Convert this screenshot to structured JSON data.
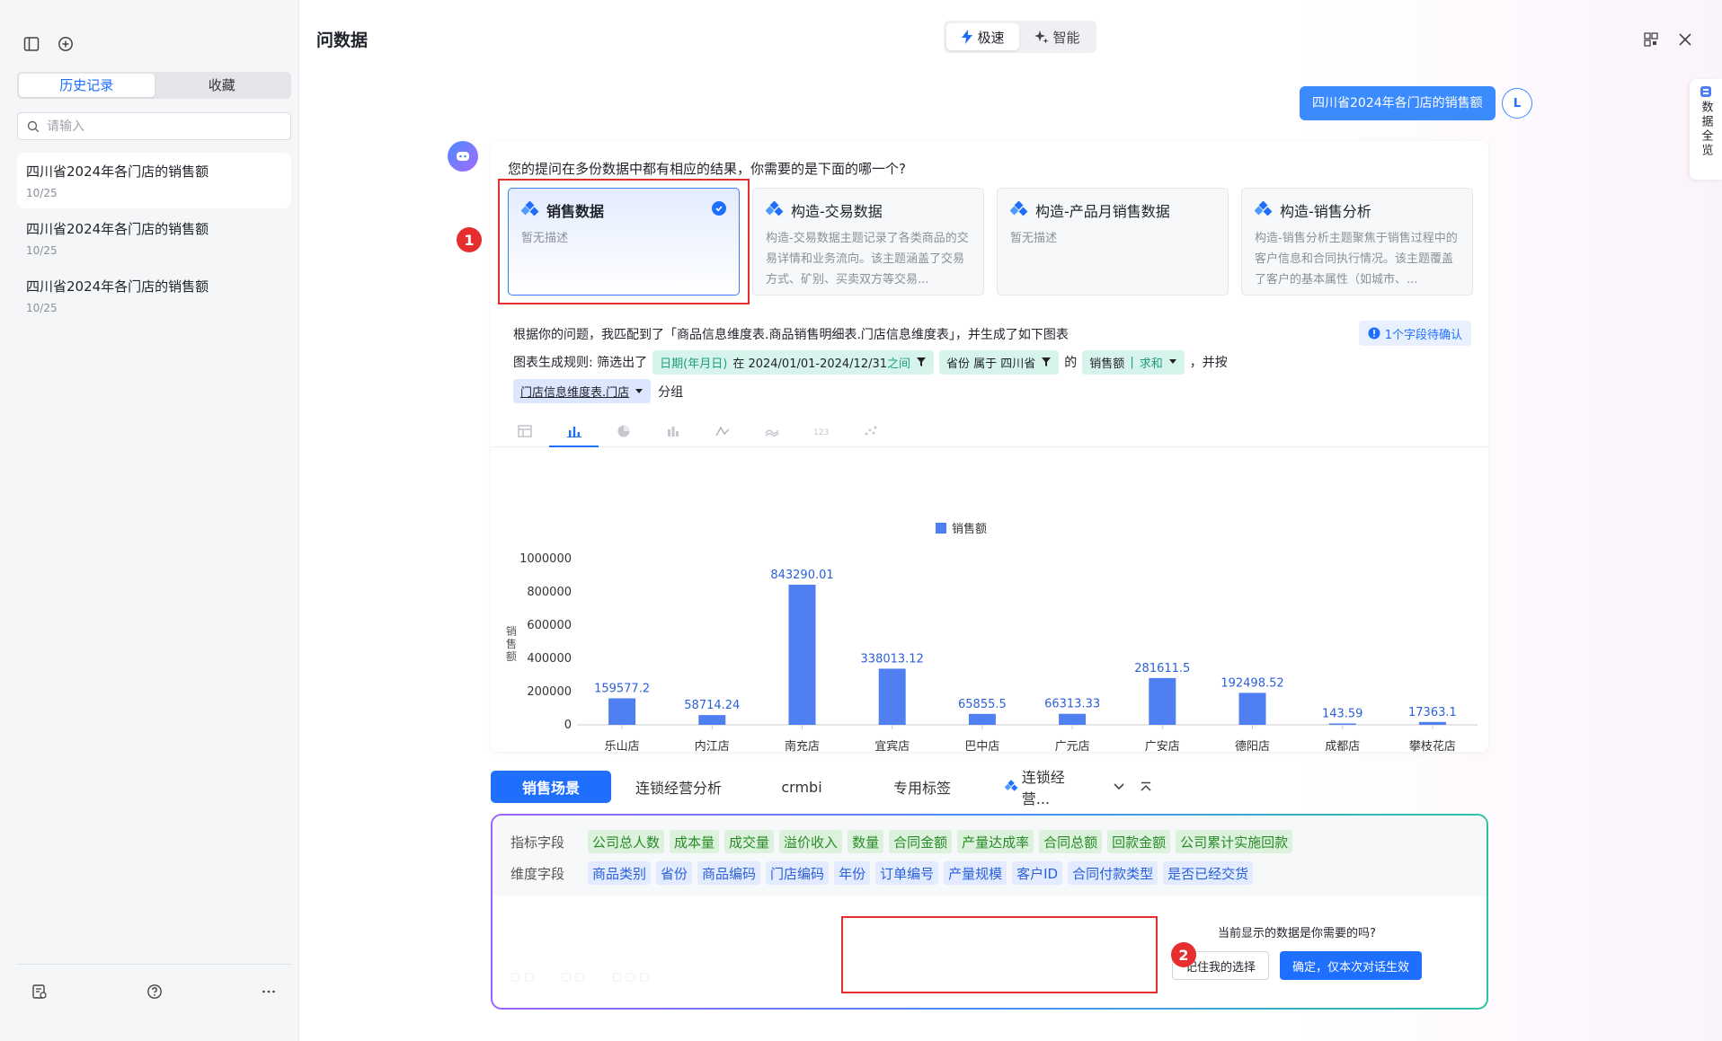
{
  "sidebar": {
    "tabs": [
      {
        "label": "历史记录"
      },
      {
        "label": "收藏"
      }
    ],
    "search_placeholder": "请输入",
    "history": [
      {
        "title": "四川省2024年各门店的销售额",
        "date": "10/25"
      },
      {
        "title": "四川省2024年各门店的销售额",
        "date": "10/25"
      },
      {
        "title": "四川省2024年各门店的销售额",
        "date": "10/25"
      }
    ]
  },
  "header": {
    "title": "问数据",
    "modes": [
      {
        "label": "极速"
      },
      {
        "label": "智能"
      }
    ],
    "side_tab": "数据全览"
  },
  "chat": {
    "user_question": "四川省2024年各门店的销售额",
    "user_initial": "L",
    "prompt": "您的提问在多份数据中都有相应的结果，你需要的是下面的哪一个?",
    "options": [
      {
        "title": "销售数据",
        "desc": "暂无描述"
      },
      {
        "title": "构造-交易数据",
        "desc": "构造-交易数据主题记录了各类商品的交易详情和业务流向。该主题涵盖了交易方式、矿别、买卖双方等交易..."
      },
      {
        "title": "构造-产品月销售数据",
        "desc": "暂无描述"
      },
      {
        "title": "构造-销售分析",
        "desc": "构造-销售分析主题聚焦于销售过程中的客户信息和合同执行情况。该主题覆盖了客户的基本属性（如城市、..."
      }
    ],
    "marker1": "1",
    "marker2": "2",
    "match_text": "根据你的问题，我匹配到了「商品信息维度表.商品销售明细表.门店信息维度表」，并生成了如下图表",
    "confirm_badge": "1个字段待确认",
    "rule_prefix": "图表生成规则: 筛选出了",
    "chip_date_key": "日期(年月日)",
    "chip_date_val": "在 2024/01/01-2024/12/31",
    "chip_date_op": "之间",
    "chip_prov": "省份 属于 四川省",
    "rule_of": "的",
    "chip_measure_key": "销售额",
    "chip_measure_sep": "|",
    "chip_measure_agg": "求和",
    "rule_and": "，并按",
    "chip_group": "门店信息维度表.门店",
    "group_suffix": "分组"
  },
  "chart_data": {
    "type": "bar",
    "legend": "销售额",
    "ylabel": "销售额",
    "ylim": [
      0,
      1000000
    ],
    "yticks": [
      0,
      200000,
      400000,
      600000,
      800000,
      1000000
    ],
    "categories": [
      "乐山店",
      "内江店",
      "南充店",
      "宜宾店",
      "巴中店",
      "广元店",
      "广安店",
      "德阳店",
      "成都店",
      "攀枝花店"
    ],
    "values": [
      159577.2,
      58714.24,
      843290.01,
      338013.12,
      65855.5,
      66313.33,
      281611.5,
      192498.52,
      143.59,
      17363.1
    ],
    "labels": [
      "159577.2",
      "58714.24",
      "843290.01",
      "338013.12",
      "65855.5",
      "66313.33",
      "281611.5",
      "192498.52",
      "143.59",
      "17363.1"
    ],
    "color": "#4f7ff0"
  },
  "scenes": [
    {
      "label": "销售场景"
    },
    {
      "label": "连锁经营分析"
    },
    {
      "label": "crmbi"
    },
    {
      "label": "专用标签"
    },
    {
      "label": "连锁经营..."
    }
  ],
  "fields": {
    "metric_label": "指标字段",
    "metrics": [
      "公司总人数",
      "成本量",
      "成交量",
      "溢价收入",
      "数量",
      "合同金额",
      "产量达成率",
      "合同总额",
      "回款金额",
      "公司累计实施回款"
    ],
    "dim_label": "维度字段",
    "dims": [
      "商品类别",
      "省份",
      "商品编码",
      "门店编码",
      "年份",
      "订单编号",
      "产量规模",
      "客户ID",
      "合同付款类型",
      "是否已经交货"
    ]
  },
  "confirm": {
    "question": "当前显示的数据是你需要的吗?",
    "remember": "记住我的选择",
    "ok": "确定，仅本次对话生效"
  }
}
